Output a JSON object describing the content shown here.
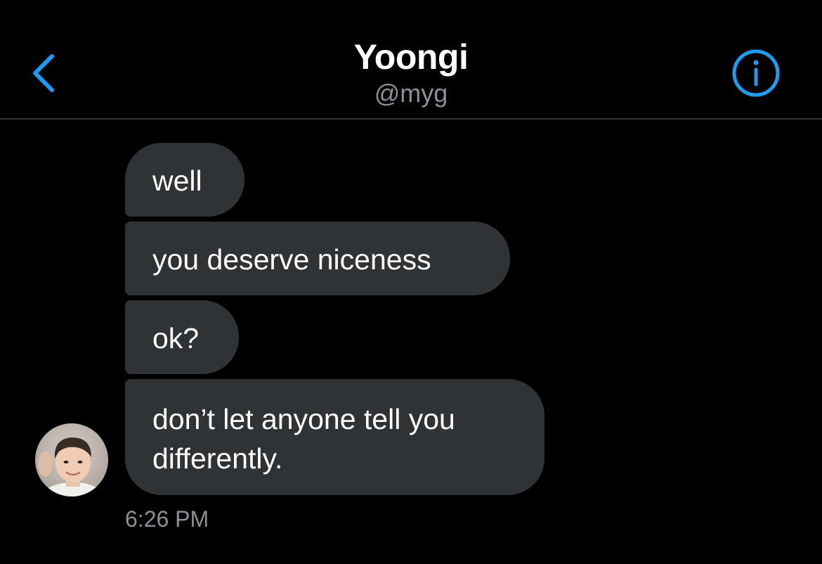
{
  "colors": {
    "background": "#000000",
    "accent": "#1d9bf0",
    "bubble": "#2f3336",
    "secondary_text": "#8b9096"
  },
  "header": {
    "title": "Yoongi",
    "handle": "@myg",
    "back_icon": "chevron-left-icon",
    "info_icon": "info-circle-icon"
  },
  "conversation": {
    "messages": [
      {
        "text": "well"
      },
      {
        "text": "you deserve niceness"
      },
      {
        "text": "ok?"
      },
      {
        "text": "don’t let anyone tell you differently."
      }
    ],
    "avatar": "avatar-photo",
    "timestamp": "6:26 PM"
  }
}
